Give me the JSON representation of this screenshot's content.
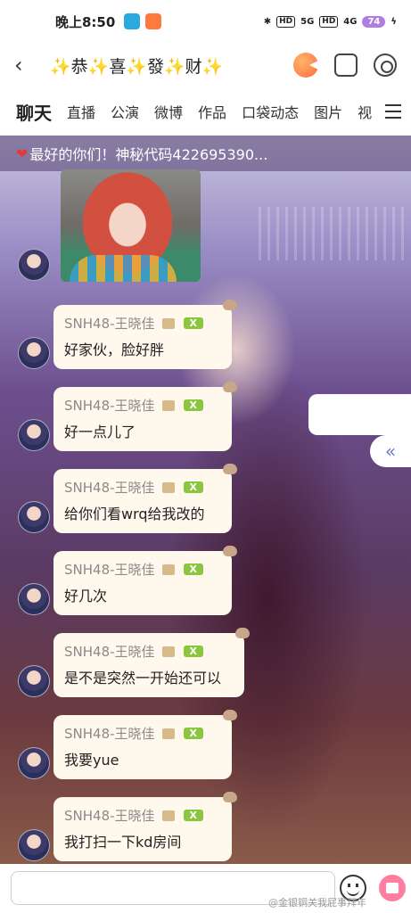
{
  "status_bar": {
    "time": "晚上8:50",
    "network_labels": [
      "HD",
      "5G",
      "HD",
      "4G"
    ],
    "battery": "74"
  },
  "header": {
    "back_icon": "chevron-left-icon",
    "title": "✨恭✨喜✨發✨财✨"
  },
  "tabs": [
    "聊天",
    "直播",
    "公演",
    "微博",
    "作品",
    "口袋动态",
    "图片",
    "视"
  ],
  "chat": {
    "notice": "最好的你们！神秘代码422695390...",
    "messages": [
      {
        "sender": "SNH48-王晓佳",
        "badge": "X",
        "text": "好家伙，脸好胖"
      },
      {
        "sender": "SNH48-王晓佳",
        "badge": "X",
        "text": "好一点儿了"
      },
      {
        "sender": "SNH48-王晓佳",
        "badge": "X",
        "text": "给你们看wrq给我改的"
      },
      {
        "sender": "SNH48-王晓佳",
        "badge": "X",
        "text": "好几次"
      },
      {
        "sender": "SNH48-王晓佳",
        "badge": "X",
        "text": "是不是突然一开始还可以"
      },
      {
        "sender": "SNH48-王晓佳",
        "badge": "X",
        "text": "我要yue"
      },
      {
        "sender": "SNH48-王晓佳",
        "badge": "X",
        "text": "我打扫一下kd房间"
      }
    ],
    "collapse_label": "«"
  },
  "input_bar": {
    "value": "",
    "watermark": "@金银铜关我屁事拜年"
  }
}
